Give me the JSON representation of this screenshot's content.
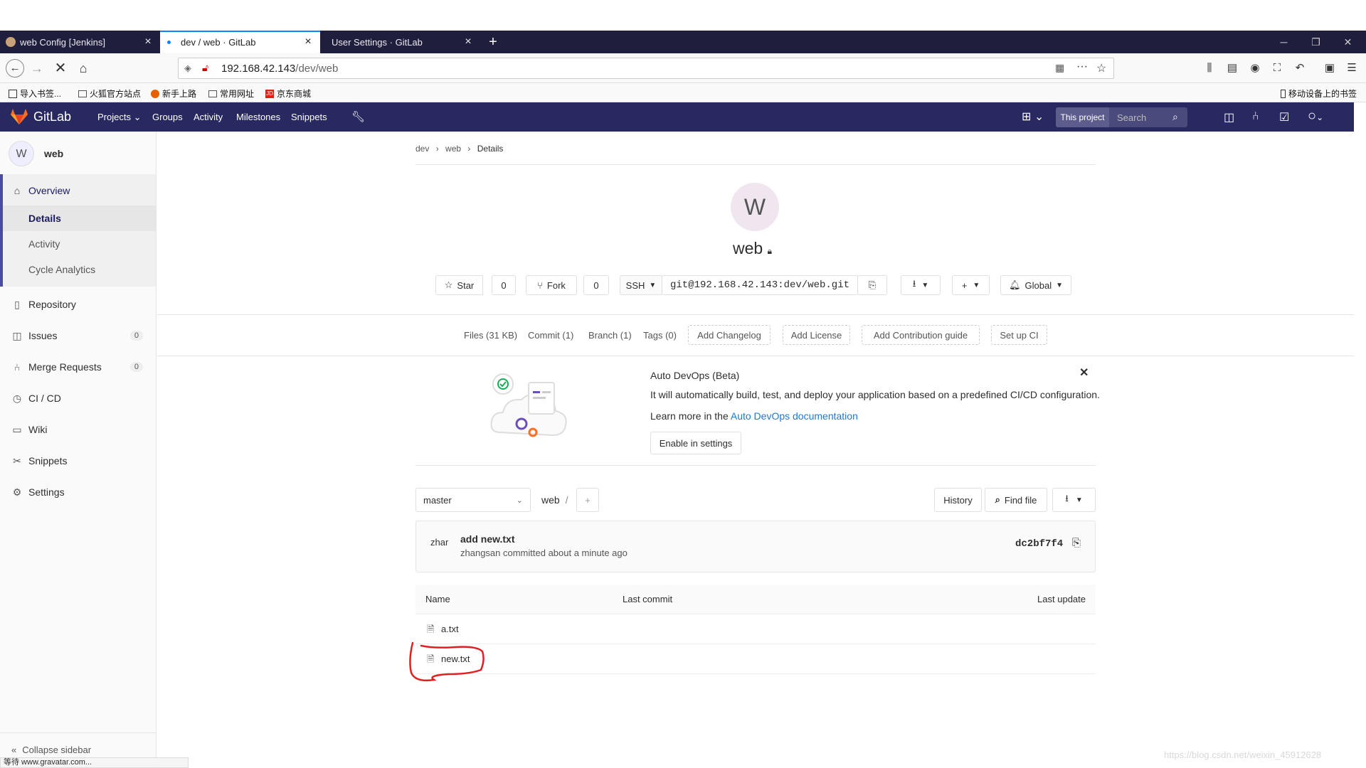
{
  "browser": {
    "tabs": [
      {
        "title": "web Config [Jenkins]",
        "active": false
      },
      {
        "title": "dev / web · GitLab",
        "active": true
      },
      {
        "title": "User Settings · GitLab",
        "active": false
      }
    ],
    "url_host": "192.168.42.143",
    "url_path": "/dev/web",
    "bookmarks": [
      "导入书签...",
      "火狐官方站点",
      "新手上路",
      "常用网址",
      "京东商城"
    ],
    "mobile_bookmarks": "移动设备上的书签",
    "status_text": "等待 www.gravatar.com...",
    "watermark": "https://blog.csdn.net/weixin_45912628"
  },
  "gitlab": {
    "brand": "GitLab",
    "nav": [
      "Projects",
      "Groups",
      "Activity",
      "Milestones",
      "Snippets"
    ],
    "scope": "This project",
    "search_placeholder": "Search"
  },
  "sidebar": {
    "project_initial": "W",
    "project_name": "web",
    "overview": "Overview",
    "overview_sub": [
      "Details",
      "Activity",
      "Cycle Analytics"
    ],
    "items": [
      {
        "label": "Repository"
      },
      {
        "label": "Issues",
        "count": "0"
      },
      {
        "label": "Merge Requests",
        "count": "0"
      },
      {
        "label": "CI / CD"
      },
      {
        "label": "Wiki"
      },
      {
        "label": "Snippets"
      },
      {
        "label": "Settings"
      }
    ],
    "collapse": "Collapse sidebar"
  },
  "breadcrumb": [
    "dev",
    "web",
    "Details"
  ],
  "project": {
    "avatar_initial": "W",
    "name": "web",
    "star_label": "Star",
    "star_count": "0",
    "fork_label": "Fork",
    "fork_count": "0",
    "protocol": "SSH",
    "clone_url": "git@192.168.42.143:dev/web.git",
    "notification": "Global"
  },
  "stats": {
    "files": "Files (31 KB)",
    "commit": "Commit (1)",
    "branch": "Branch (1)",
    "tags": "Tags (0)",
    "add_changelog": "Add Changelog",
    "add_license": "Add License",
    "add_contribution": "Add Contribution guide",
    "setup_ci": "Set up CI"
  },
  "devops": {
    "title": "Auto DevOps (Beta)",
    "description": "It will automatically build, test, and deploy your application based on a predefined CI/CD configuration.",
    "learn_prefix": "Learn more in the",
    "learn_link": "Auto DevOps documentation",
    "enable_button": "Enable in settings"
  },
  "tree": {
    "branch": "master",
    "path": "web",
    "path_sep": "/",
    "history": "History",
    "find_file": "Find file"
  },
  "commit": {
    "avatar_text": "zhar",
    "message": "add new.txt",
    "meta": "zhangsan committed about a minute ago",
    "sha": "dc2bf7f4"
  },
  "files": {
    "headers": [
      "Name",
      "Last commit",
      "Last update"
    ],
    "rows": [
      {
        "name": "a.txt"
      },
      {
        "name": "new.txt"
      }
    ]
  },
  "colors": {
    "gitlab_header": "#292961",
    "link": "#1f78d1",
    "annotation": "#e02020"
  }
}
